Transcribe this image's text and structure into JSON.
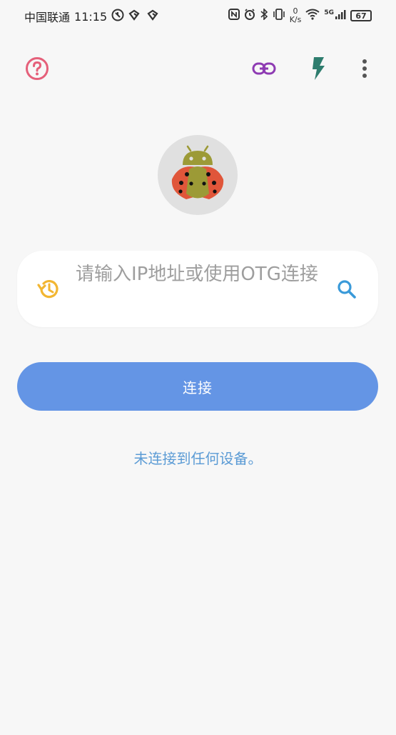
{
  "status_bar": {
    "carrier": "中国联通",
    "time": "11:15",
    "network_speed_value": "0",
    "network_speed_unit": "K/s",
    "signal_label": "5G",
    "battery": "67"
  },
  "toolbar": {
    "help_icon": "help-icon",
    "link_icon": "link-icon",
    "flash_icon": "flash-icon",
    "more_icon": "more-vert-icon"
  },
  "search": {
    "placeholder": "请输入IP地址或使用OTG连接"
  },
  "connect_button": {
    "label": "连接"
  },
  "connection_status": "未连接到任何设备。",
  "colors": {
    "help": "#e5607a",
    "link": "#8e3bb3",
    "flash": "#2e7d6e",
    "history": "#f2b632",
    "search": "#3a9ad9",
    "button": "#6495e5",
    "status_text": "#5b9bd5"
  }
}
